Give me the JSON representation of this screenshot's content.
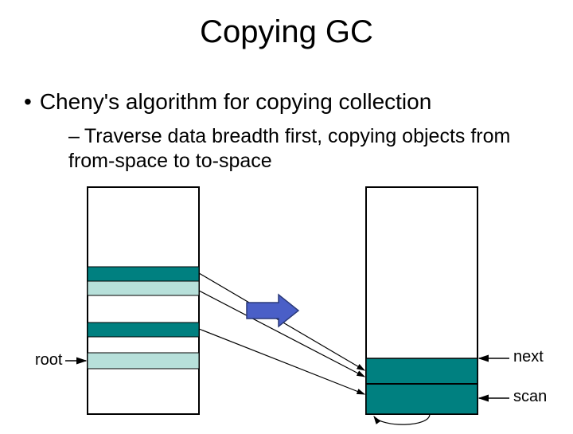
{
  "title": "Copying GC",
  "bullet": "Cheny's algorithm for copying collection",
  "subbullet": "Traverse data breadth first, copying objects from from-space to to-space",
  "labels": {
    "root": "root",
    "next": "next",
    "scan": "scan"
  },
  "colors": {
    "dark_teal": "#008080",
    "light_teal": "#b7e0da",
    "arrow_blue": "#3b4ea3",
    "arrow_fill": "#4a5fc7"
  }
}
